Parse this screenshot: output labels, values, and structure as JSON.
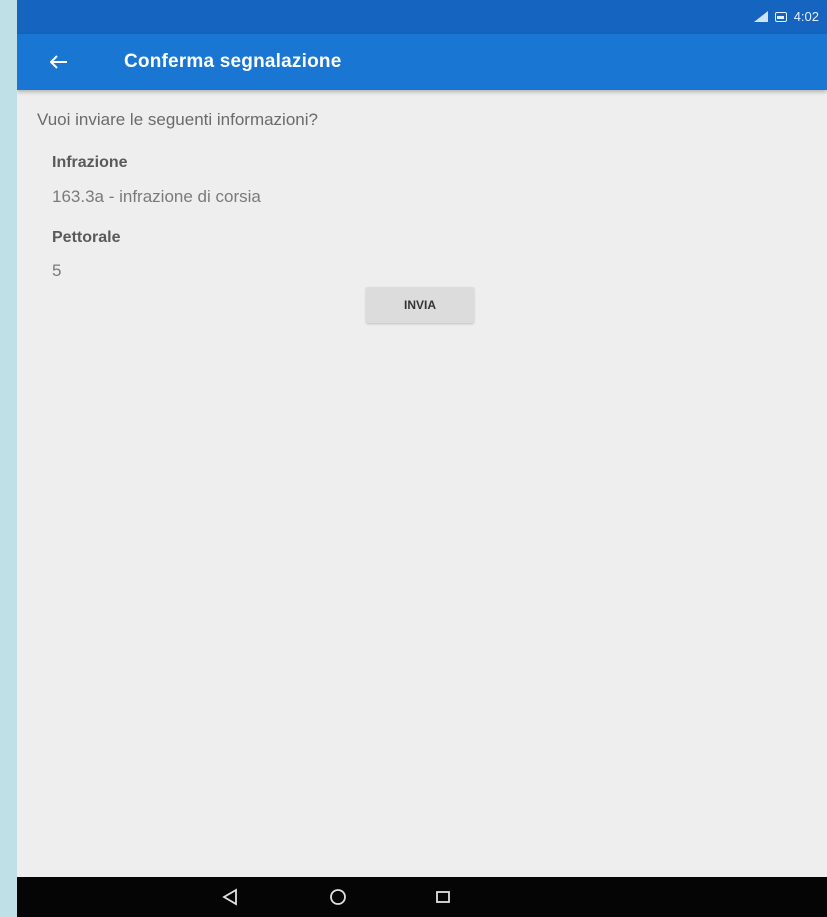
{
  "status_bar": {
    "time": "4:02",
    "icons": [
      "signal-icon",
      "battery-icon"
    ]
  },
  "app_bar": {
    "back_icon": "arrow-left-icon",
    "title": "Conferma segnalazione",
    "color": "#1976d2"
  },
  "content": {
    "prompt": "Vuoi inviare le seguenti informazioni?",
    "fields": [
      {
        "label": "Infrazione",
        "value": "163.3a - infrazione di corsia"
      },
      {
        "label": "Pettorale",
        "value": "5"
      }
    ],
    "send_label": "INVIA"
  },
  "nav_bar": {
    "icons": [
      "back-triangle-icon",
      "home-circle-icon",
      "recents-square-icon"
    ]
  }
}
